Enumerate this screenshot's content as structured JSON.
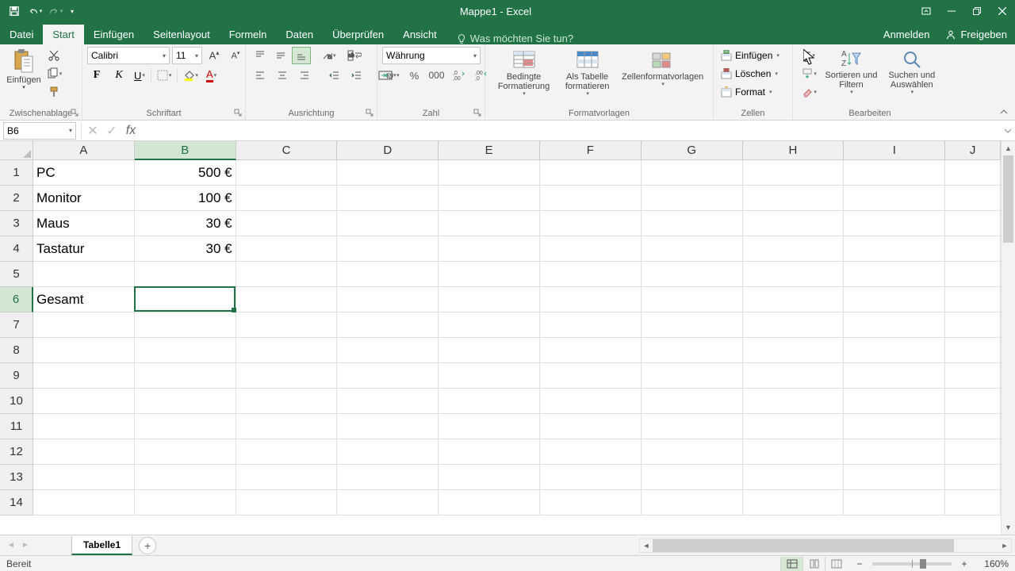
{
  "app": {
    "title": "Mappe1 - Excel"
  },
  "tabs": {
    "file": "Datei",
    "items": [
      "Start",
      "Einfügen",
      "Seitenlayout",
      "Formeln",
      "Daten",
      "Überprüfen",
      "Ansicht"
    ],
    "active_index": 0,
    "tellme_placeholder": "Was möchten Sie tun?",
    "signin": "Anmelden",
    "share": "Freigeben"
  },
  "ribbon": {
    "clipboard": {
      "paste": "Einfügen",
      "label": "Zwischenablage"
    },
    "font": {
      "name": "Calibri",
      "size": "11",
      "label": "Schriftart"
    },
    "alignment": {
      "label": "Ausrichtung"
    },
    "number": {
      "format": "Währung",
      "label": "Zahl"
    },
    "styles": {
      "cond": "Bedingte Formatierung",
      "table": "Als Tabelle formatieren",
      "cellstyles": "Zellenformatvorlagen",
      "label": "Formatvorlagen"
    },
    "cells": {
      "insert": "Einfügen",
      "delete": "Löschen",
      "format": "Format",
      "label": "Zellen"
    },
    "editing": {
      "sort": "Sortieren und Filtern",
      "find": "Suchen und Auswählen",
      "label": "Bearbeiten"
    }
  },
  "formula_bar": {
    "name_box": "B6",
    "cancel": "✕",
    "enter": "✓",
    "fx": "fx",
    "formula": ""
  },
  "columns": [
    "A",
    "B",
    "C",
    "D",
    "E",
    "F",
    "G",
    "H",
    "I",
    "J"
  ],
  "col_widths": {
    "A": 128,
    "B": 128,
    "C": 128,
    "D": 128,
    "E": 128,
    "F": 128,
    "G": 128,
    "H": 128,
    "I": 128,
    "J": 70
  },
  "selected_col": "B",
  "selected_row": 6,
  "rows_visible": 14,
  "cells": {
    "A1": "PC",
    "B1": "500 €",
    "A2": "Monitor",
    "B2": "100 €",
    "A3": "Maus",
    "B3": "30 €",
    "A4": "Tastatur",
    "B4": "30 €",
    "A6": "Gesamt"
  },
  "right_aligned_cols": [
    "B"
  ],
  "sheet": {
    "tab": "Tabelle1"
  },
  "status": {
    "ready": "Bereit",
    "zoom": "160%"
  }
}
